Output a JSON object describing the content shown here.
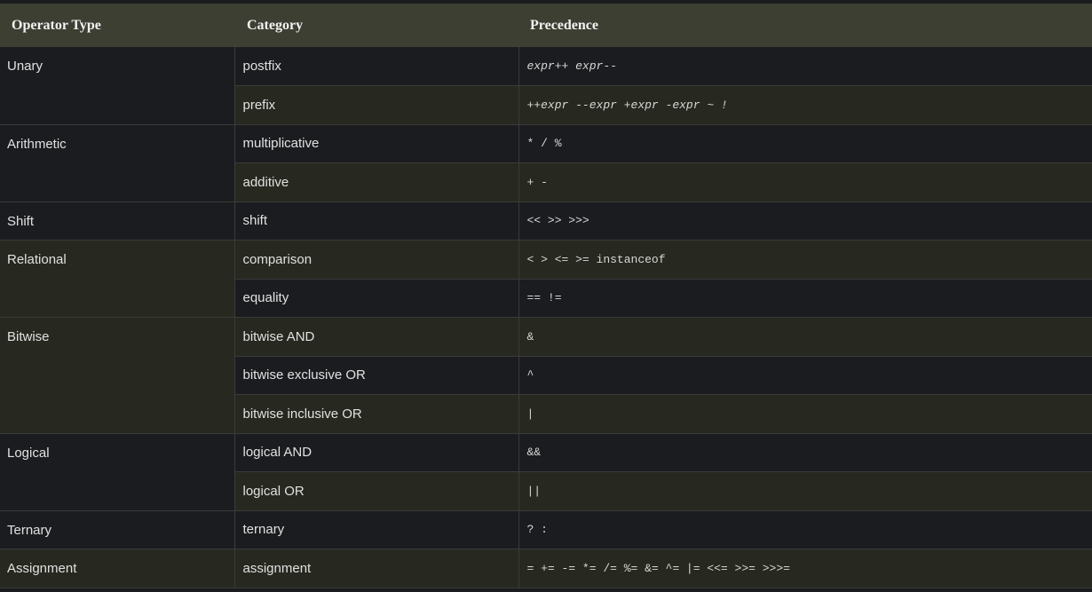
{
  "headers": {
    "operator_type": "Operator Type",
    "category": "Category",
    "precedence": "Precedence"
  },
  "groups": [
    {
      "type": "Unary",
      "rows": [
        {
          "category": "postfix",
          "precedence": "expr++ expr--"
        },
        {
          "category": "prefix",
          "precedence": "++expr --expr +expr -expr ~ !"
        }
      ]
    },
    {
      "type": "Arithmetic",
      "rows": [
        {
          "category": "multiplicative",
          "precedence": "* / %"
        },
        {
          "category": "additive",
          "precedence": "+ -"
        }
      ]
    },
    {
      "type": "Shift",
      "rows": [
        {
          "category": "shift",
          "precedence": "<< >> >>>"
        }
      ]
    },
    {
      "type": "Relational",
      "rows": [
        {
          "category": "comparison",
          "precedence": "< > <= >= instanceof"
        },
        {
          "category": "equality",
          "precedence": "== !="
        }
      ]
    },
    {
      "type": "Bitwise",
      "rows": [
        {
          "category": "bitwise AND",
          "precedence": "&"
        },
        {
          "category": "bitwise exclusive OR",
          "precedence": "^"
        },
        {
          "category": "bitwise inclusive OR",
          "precedence": "|"
        }
      ]
    },
    {
      "type": "Logical",
      "rows": [
        {
          "category": "logical AND",
          "precedence": "&&"
        },
        {
          "category": "logical OR",
          "precedence": "||"
        }
      ]
    },
    {
      "type": "Ternary",
      "rows": [
        {
          "category": "ternary",
          "precedence": "? :"
        }
      ]
    },
    {
      "type": "Assignment",
      "rows": [
        {
          "category": "assignment",
          "precedence": "= += -= *= /= %= &= ^= |= <<= >>= >>>="
        }
      ]
    }
  ]
}
